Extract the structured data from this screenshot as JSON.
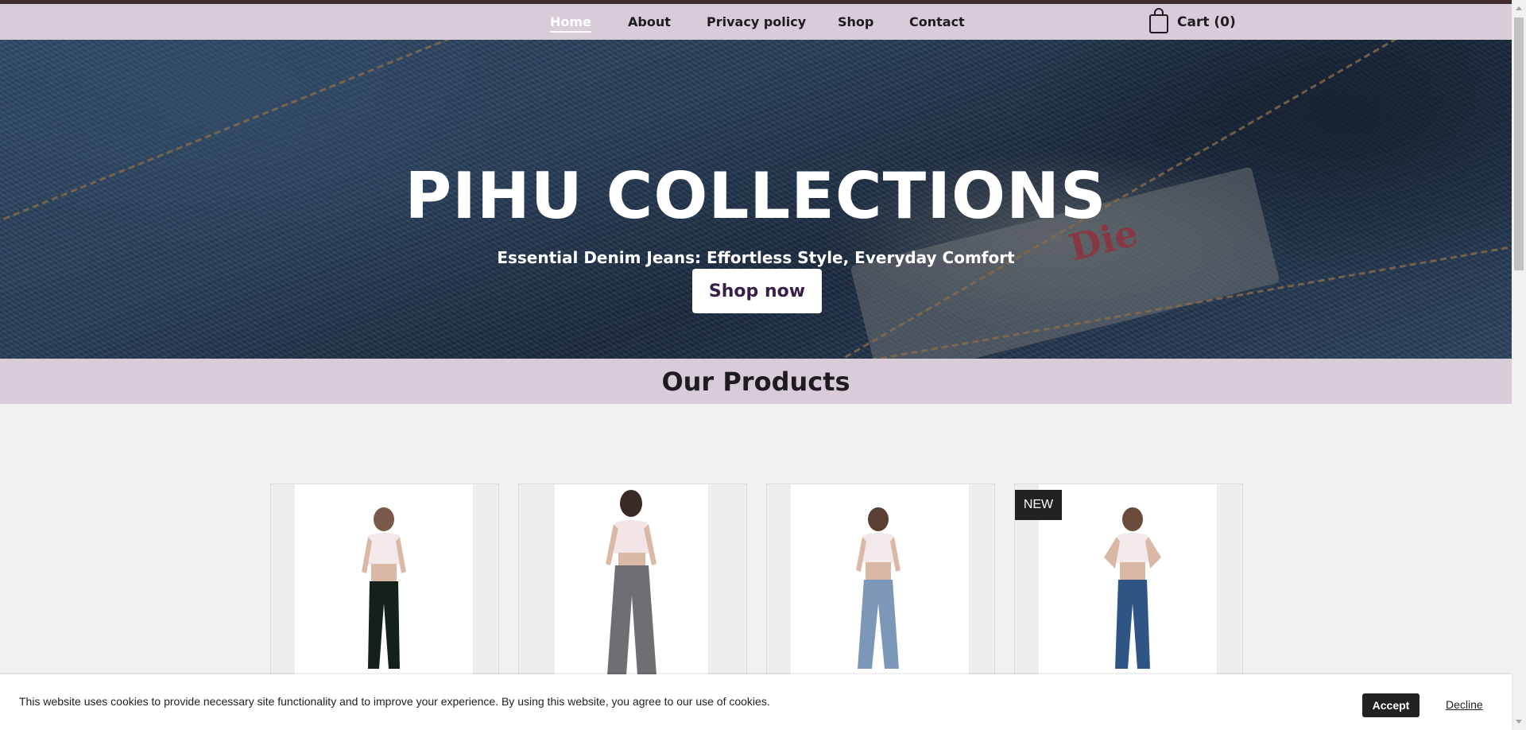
{
  "nav": {
    "items": [
      {
        "label": "Home",
        "active": true
      },
      {
        "label": "About"
      },
      {
        "label": "Privacy policy"
      },
      {
        "label": "Shop"
      },
      {
        "label": "Contact"
      }
    ],
    "cart_label": "Cart (0)",
    "cart_icon": "shopping-bag-icon"
  },
  "hero": {
    "title": "PIHU COLLECTIONS",
    "subtitle": "Essential Denim Jeans: Effortless Style, Everyday Comfort",
    "cta_label": "Shop now",
    "background_label_text": "Die"
  },
  "products": {
    "section_title": "Our Products",
    "cards": [
      {
        "jeans_color": "#15201a"
      },
      {
        "jeans_color": "#6e6f72"
      },
      {
        "jeans_color": "#7d97b8"
      },
      {
        "jeans_color": "#2f5584",
        "badge": "NEW"
      }
    ]
  },
  "cookie": {
    "message": "This website uses cookies to provide necessary site functionality and to improve your experience. By using this website, you agree to our use of cookies.",
    "accept_label": "Accept",
    "decline_label": "Decline"
  },
  "colors": {
    "nav_bg": "#d8ccd8",
    "accent_text": "#3b1d4a",
    "top_strip": "#3d2b2e"
  }
}
